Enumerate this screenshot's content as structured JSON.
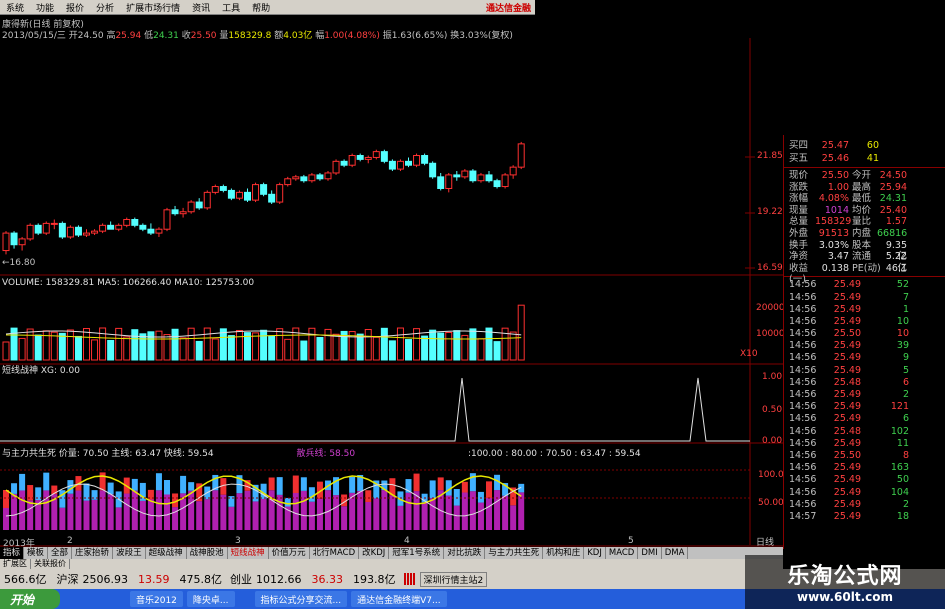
{
  "menu": [
    "系统",
    "功能",
    "报价",
    "分析",
    "扩展市场行情",
    "资讯",
    "工具",
    "帮助"
  ],
  "brand": "通达信金融",
  "title_line": "康得新(日线 前复权)",
  "info": {
    "date": "2013/05/15/三",
    "open_label": "开",
    "open": "24.50",
    "high_label": "高",
    "high": "25.94",
    "low_label": "低",
    "low": "24.31",
    "close_label": "收",
    "close": "25.50",
    "vol_label": "量",
    "vol": "158329.8",
    "amt_label": "额",
    "amt": "4.03亿",
    "chg_label": "幅",
    "chg": "1.00(4.08%)",
    "amp_label": "振",
    "amp": "1.63(6.65%)",
    "turn_label": "换",
    "turn": "3.03%(复权)"
  },
  "price_axis": [
    "21.85",
    "19.22",
    "16.59"
  ],
  "low_marker": "←16.80",
  "volume_label": "VOLUME: 158329.81  MA5: 106266.40  MA10: 125753.00",
  "vol_axis": [
    "20000",
    "10000",
    "X10"
  ],
  "short_label": "短线战神  XG: 0.00",
  "short_axis": [
    "1.00",
    "0.50",
    "0.00"
  ],
  "ind_label_parts": [
    {
      "t": "与主力共生死  价量: 70.50  主线: 63.47  快线: 59.54",
      "c": "#e0e0e0"
    },
    {
      "t": "散兵线: 58.50",
      "c": "#d040d0"
    },
    {
      "t": ":100.00 : 80.00 : 70.50 : 63.47 : 59.54",
      "c": "#e0e0e0"
    }
  ],
  "ind_axis": [
    "100.0",
    "50.00"
  ],
  "x_axis": {
    "year": "2013年",
    "marks": [
      "2",
      "3",
      "4",
      "5"
    ]
  },
  "quote_rows": [
    {
      "label": "买四",
      "price": "25.47",
      "vol": "60"
    },
    {
      "label": "买五",
      "price": "25.46",
      "vol": "41"
    }
  ],
  "stats": [
    [
      "现价",
      "25.50",
      "今开",
      "24.50"
    ],
    [
      "涨跌",
      "1.00",
      "最高",
      "25.94"
    ],
    [
      "涨幅",
      "4.08%",
      "最低",
      "24.31"
    ],
    [
      "现量",
      "1014",
      "均价",
      "25.40"
    ],
    [
      "总量",
      "158329",
      "量比",
      "1.57"
    ],
    [
      "外盘",
      "91513",
      "内盘",
      "66816"
    ],
    [
      "换手",
      "3.03%",
      "股本",
      "9.35亿"
    ],
    [
      "净资",
      "3.47",
      "流通",
      "5.22亿"
    ],
    [
      "收益(一)",
      "0.138",
      "PE(动)",
      "46.1"
    ]
  ],
  "ticks": [
    [
      "14:56",
      "25.49",
      "52",
      "up"
    ],
    [
      "14:56",
      "25.49",
      "7",
      "up"
    ],
    [
      "14:56",
      "25.49",
      "1",
      "up"
    ],
    [
      "14:56",
      "25.49",
      "10",
      "up"
    ],
    [
      "14:56",
      "25.50",
      "10",
      "dn"
    ],
    [
      "14:56",
      "25.49",
      "39",
      "up"
    ],
    [
      "14:56",
      "25.49",
      "9",
      "up"
    ],
    [
      "14:56",
      "25.49",
      "5",
      "up"
    ],
    [
      "14:56",
      "25.48",
      "6",
      "dn"
    ],
    [
      "14:56",
      "25.49",
      "2",
      "up"
    ],
    [
      "14:56",
      "25.49",
      "121",
      "dn"
    ],
    [
      "14:56",
      "25.49",
      "6",
      "up"
    ],
    [
      "14:56",
      "25.48",
      "102",
      "up"
    ],
    [
      "14:56",
      "25.49",
      "11",
      "up"
    ],
    [
      "14:56",
      "25.50",
      "8",
      "dn"
    ],
    [
      "14:56",
      "25.49",
      "163",
      "up"
    ],
    [
      "14:56",
      "25.49",
      "50",
      "up"
    ],
    [
      "14:56",
      "25.49",
      "104",
      "up"
    ],
    [
      "14:56",
      "25.49",
      "2",
      "up"
    ],
    [
      "14:57",
      "25.49",
      "18",
      "up"
    ]
  ],
  "tabs": [
    "指标",
    "模板",
    "全部",
    "庄家抬轿",
    "波段王",
    "超级战神",
    "战神股池",
    "短线战神",
    "价值万元",
    "北行MACD",
    "改KDJ",
    "冠军1号系统",
    "对比抗跌",
    "与主力共生死",
    "机构和庄",
    "KDJ",
    "MACD",
    "DMI",
    "DMA"
  ],
  "tabs2": [
    "扩展区",
    "关联报价"
  ],
  "status": {
    "a": "566.6亿",
    "b": "沪深",
    "c": "2506.93",
    "d": "13.59",
    "e": "475.8亿",
    "f": "创业",
    "g": "1012.66",
    "h": "36.33",
    "i": "193.8亿",
    "j": "深圳行情主站2"
  },
  "taskbar": [
    "开始",
    "音乐2012",
    "降央卓...",
    "指标公式分享交流...",
    "通达信金融终端V7..."
  ],
  "watermark": {
    "cn": "乐淘公式网",
    "url": "www.60lt.com"
  },
  "day_tab": "日线",
  "colors": {
    "up": "#ff3030",
    "down": "#54ffff",
    "grid": "#800000"
  },
  "chart_data": {
    "type": "candlestick",
    "candles": [
      [
        16.9,
        17.9,
        16.7,
        17.8
      ],
      [
        17.8,
        17.9,
        17.0,
        17.2
      ],
      [
        17.2,
        17.6,
        16.9,
        17.5
      ],
      [
        17.5,
        18.3,
        17.4,
        18.2
      ],
      [
        18.2,
        18.3,
        17.7,
        17.8
      ],
      [
        17.8,
        18.4,
        17.7,
        18.3
      ],
      [
        18.3,
        18.5,
        18.0,
        18.3
      ],
      [
        18.3,
        18.4,
        17.5,
        17.6
      ],
      [
        17.6,
        18.2,
        17.5,
        18.1
      ],
      [
        18.1,
        18.2,
        17.6,
        17.7
      ],
      [
        17.7,
        18.0,
        17.6,
        17.8
      ],
      [
        17.8,
        18.0,
        17.7,
        17.9
      ],
      [
        17.9,
        18.3,
        17.8,
        18.2
      ],
      [
        18.2,
        18.4,
        18.0,
        18.0
      ],
      [
        18.0,
        18.3,
        17.9,
        18.2
      ],
      [
        18.2,
        18.6,
        18.1,
        18.5
      ],
      [
        18.5,
        18.6,
        18.1,
        18.2
      ],
      [
        18.2,
        18.3,
        17.9,
        18.0
      ],
      [
        18.0,
        18.3,
        17.7,
        17.8
      ],
      [
        17.8,
        18.1,
        17.6,
        18.0
      ],
      [
        18.0,
        19.1,
        17.9,
        19.0
      ],
      [
        19.0,
        19.2,
        18.7,
        18.8
      ],
      [
        18.8,
        19.1,
        18.6,
        18.9
      ],
      [
        18.9,
        19.5,
        18.8,
        19.4
      ],
      [
        19.4,
        19.6,
        19.0,
        19.1
      ],
      [
        19.1,
        20.0,
        19.0,
        19.9
      ],
      [
        19.9,
        20.3,
        19.8,
        20.2
      ],
      [
        20.2,
        20.3,
        19.9,
        20.0
      ],
      [
        20.0,
        20.1,
        19.5,
        19.6
      ],
      [
        19.6,
        20.0,
        19.5,
        19.9
      ],
      [
        19.9,
        20.1,
        19.4,
        19.5
      ],
      [
        19.5,
        20.4,
        19.4,
        20.3
      ],
      [
        20.3,
        20.4,
        19.7,
        19.8
      ],
      [
        19.8,
        20.0,
        19.3,
        19.4
      ],
      [
        19.4,
        20.4,
        19.3,
        20.3
      ],
      [
        20.3,
        20.7,
        20.2,
        20.6
      ],
      [
        20.6,
        20.8,
        20.5,
        20.7
      ],
      [
        20.7,
        20.8,
        20.4,
        20.5
      ],
      [
        20.5,
        20.9,
        20.4,
        20.8
      ],
      [
        20.8,
        20.9,
        20.5,
        20.6
      ],
      [
        20.6,
        21.0,
        20.5,
        20.9
      ],
      [
        20.9,
        21.6,
        20.8,
        21.5
      ],
      [
        21.5,
        21.6,
        21.2,
        21.3
      ],
      [
        21.3,
        21.9,
        21.2,
        21.8
      ],
      [
        21.8,
        21.9,
        21.5,
        21.6
      ],
      [
        21.6,
        21.8,
        21.4,
        21.7
      ],
      [
        21.7,
        22.1,
        21.6,
        22.0
      ],
      [
        22.0,
        22.1,
        21.4,
        21.5
      ],
      [
        21.5,
        21.6,
        21.0,
        21.1
      ],
      [
        21.1,
        21.6,
        21.0,
        21.5
      ],
      [
        21.5,
        21.7,
        21.2,
        21.3
      ],
      [
        21.3,
        21.9,
        21.2,
        21.8
      ],
      [
        21.8,
        21.9,
        21.3,
        21.4
      ],
      [
        21.4,
        21.5,
        20.6,
        20.7
      ],
      [
        20.7,
        20.9,
        20.0,
        20.1
      ],
      [
        20.1,
        20.9,
        19.9,
        20.8
      ],
      [
        20.8,
        21.0,
        20.5,
        20.7
      ],
      [
        20.7,
        21.1,
        20.6,
        21.0
      ],
      [
        21.0,
        21.1,
        20.4,
        20.5
      ],
      [
        20.5,
        20.9,
        20.4,
        20.8
      ],
      [
        20.8,
        21.0,
        20.4,
        20.5
      ],
      [
        20.5,
        20.6,
        20.1,
        20.2
      ],
      [
        20.2,
        20.9,
        20.1,
        20.8
      ],
      [
        20.8,
        21.3,
        20.6,
        21.2
      ],
      [
        21.2,
        22.5,
        21.1,
        22.4
      ]
    ]
  }
}
